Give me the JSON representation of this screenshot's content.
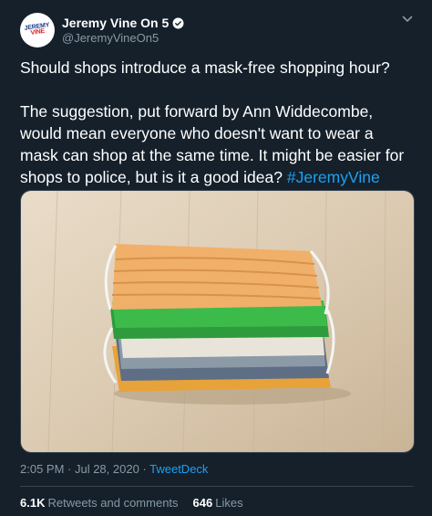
{
  "author": {
    "display_name": "Jeremy Vine On 5",
    "handle": "@JeremyVineOn5",
    "avatar_text_1": "JEREMY",
    "avatar_text_2": "VINE"
  },
  "tweet": {
    "paragraph_1": "Should shops introduce a mask-free shopping hour?",
    "paragraph_2": "The suggestion, put forward by Ann Widdecombe, would mean everyone who doesn't want to wear a mask can shop at the same time. It might be easier for shops to police, but is it a good idea?",
    "hashtag": "#JeremyVine",
    "time": "2:05 PM · Jul 28, 2020 · ",
    "client": "TweetDeck"
  },
  "stats": {
    "retweets_count": "6.1K",
    "retweets_label": "Retweets and comments",
    "likes_count": "646",
    "likes_label": "Likes"
  },
  "colors": {
    "background": "#15202b",
    "link": "#1da1f2",
    "secondary_text": "#8899a6"
  },
  "icons": [
    "verified-badge-icon",
    "chevron-down-icon"
  ]
}
